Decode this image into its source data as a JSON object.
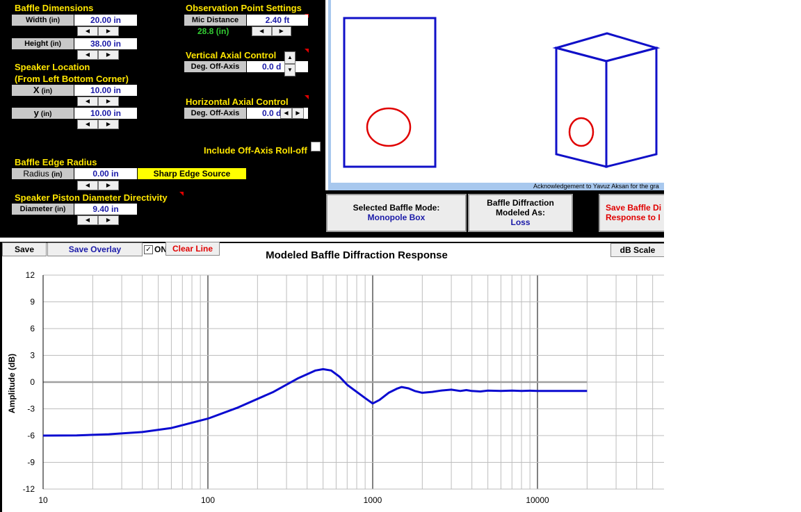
{
  "controls": {
    "baffle_dimensions": {
      "title": "Baffle Dimensions",
      "width_label": "Width",
      "width_unit": "(in)",
      "width_value": "20.00 in",
      "height_label": "Height",
      "height_unit": "(in)",
      "height_value": "38.00 in"
    },
    "speaker_location": {
      "title_line1": "Speaker Location",
      "title_line2": "(From Left Bottom Corner)",
      "x_label": "X",
      "x_unit": "(in)",
      "x_value": "10.00 in",
      "y_label": "y",
      "y_unit": "(in)",
      "y_value": "10.00 in"
    },
    "observation": {
      "title": "Observation Point Settings",
      "mic_label": "Mic Distance",
      "mic_value": "2.40 ft",
      "mic_inches": "28.8 (in)"
    },
    "vertical_axial": {
      "title": "Vertical Axial Control",
      "deg_label": "Deg. Off-Axis",
      "deg_value": "0.0 d"
    },
    "horizontal_axial": {
      "title": "Horizontal Axial Control",
      "deg_label": "Deg. Off-Axis",
      "deg_value": "0.0 d"
    },
    "include_rolloff_label": "Include Off-Axis Roll-off",
    "edge_radius": {
      "title": "Baffle Edge Radius",
      "radius_label": "Radius",
      "radius_unit": "(in)",
      "radius_value": "0.00 in",
      "source_badge": "Sharp Edge Source"
    },
    "piston": {
      "title": "Speaker Piston Diameter Directivity",
      "diameter_label": "Diameter",
      "diameter_unit": "(in)",
      "diameter_value": "9.40 in"
    }
  },
  "spinner": {
    "left": "◀",
    "right": "▶",
    "up": "▲",
    "down": "▼"
  },
  "acknowledgement": "Acknowledgement to Yavuz Aksan for the gra",
  "mode_panel": {
    "selected_label": "Selected Baffle Mode:",
    "selected_value": "Monopole Box",
    "modeled_line1": "Baffle Diffraction",
    "modeled_line2": "Modeled As:",
    "modeled_value": "Loss",
    "save_line1": "Save Baffle Di",
    "save_line2": "Response to I"
  },
  "toolbar": {
    "save": "Save",
    "save_overlay": "Save Overlay",
    "on_check": "✓",
    "on_label": "ON",
    "clear_line": "Clear Line",
    "db_scale": "dB Scale"
  },
  "colors": {
    "section_title": "#ffe600",
    "value_text": "#1a1aa8",
    "circle_red": "#e00000",
    "baffle_blue": "#1010c8",
    "curve_blue": "#0a0ad0",
    "zero_line": "#a0a0a0"
  },
  "chart_data": {
    "type": "line",
    "title": "Modeled Baffle Diffraction Response",
    "xlabel": "",
    "ylabel": "Amplitude (dB)",
    "x_scale": "log",
    "xlim": [
      10,
      20000
    ],
    "ylim": [
      -12,
      12
    ],
    "x_ticks": [
      "10",
      "100",
      "1000",
      "10000"
    ],
    "y_ticks": [
      "12",
      "9",
      "6",
      "3",
      "0",
      "-3",
      "-6",
      "-9",
      "-12"
    ],
    "grid": true,
    "series": [
      {
        "x": [
          10,
          16,
          25,
          40,
          60,
          100,
          150,
          250,
          350,
          450,
          500,
          560,
          630,
          700,
          800,
          900,
          1000,
          1100,
          1250,
          1400,
          1500,
          1650,
          1800,
          2000,
          2300,
          2600,
          3000,
          3400,
          3700,
          4000,
          4500,
          5000,
          6000,
          7000,
          8000,
          9000,
          10000,
          12000,
          15000,
          20000
        ],
        "y": [
          -6.0,
          -5.98,
          -5.85,
          -5.6,
          -5.15,
          -4.1,
          -2.9,
          -1.1,
          0.4,
          1.3,
          1.45,
          1.3,
          0.6,
          -0.3,
          -1.1,
          -1.8,
          -2.4,
          -2.0,
          -1.2,
          -0.75,
          -0.55,
          -0.7,
          -1.0,
          -1.2,
          -1.1,
          -0.95,
          -0.85,
          -1.0,
          -0.9,
          -1.0,
          -1.05,
          -0.95,
          -1.0,
          -0.95,
          -1.0,
          -0.97,
          -1.0,
          -1.0,
          -1.0,
          -1.0
        ]
      }
    ]
  }
}
